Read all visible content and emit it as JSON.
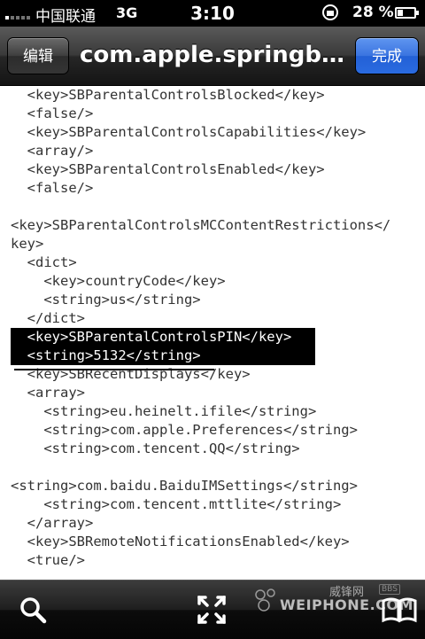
{
  "status_bar": {
    "carrier": "中国联通",
    "network": "3G",
    "time": "3:10",
    "battery_percent": "28 %",
    "signal_bars": 1
  },
  "nav": {
    "edit_label": "编辑",
    "title": "com.apple.springb…",
    "done_label": "完成"
  },
  "document": {
    "lines": [
      {
        "text": "  <key>SBParentalControlsBlocked</key>"
      },
      {
        "text": "  <false/>"
      },
      {
        "text": "  <key>SBParentalControlsCapabilities</key>"
      },
      {
        "text": "  <array/>"
      },
      {
        "text": "  <key>SBParentalControlsEnabled</key>"
      },
      {
        "text": "  <false/>"
      },
      {
        "text": ""
      },
      {
        "text": "<key>SBParentalControlsMCContentRestrictions</"
      },
      {
        "text": "key>"
      },
      {
        "text": "  <dict>"
      },
      {
        "text": "    <key>countryCode</key>"
      },
      {
        "text": "    <string>us</string>"
      },
      {
        "text": "  </dict>"
      },
      {
        "text": "  <key>SBParentalControlsPIN</key>",
        "highlight": true
      },
      {
        "text": "  <string>5132</string>",
        "highlight": true
      },
      {
        "text": "  <key>SBRecentDisplays</key>"
      },
      {
        "text": "  <array>"
      },
      {
        "text": "    <string>eu.heinelt.ifile</string>"
      },
      {
        "text": "    <string>com.apple.Preferences</string>"
      },
      {
        "text": "    <string>com.tencent.QQ</string>"
      },
      {
        "text": ""
      },
      {
        "text": "<string>com.baidu.BaiduIMSettings</string>"
      },
      {
        "text": "    <string>com.tencent.mttlite</string>"
      },
      {
        "text": "  </array>"
      },
      {
        "text": "  <key>SBRemoteNotificationsEnabled</key>"
      },
      {
        "text": "  <true/>"
      }
    ]
  },
  "toolbar": {
    "icons": [
      "search-icon",
      "fullscreen-icon",
      "bookmarks-icon"
    ]
  },
  "watermark": {
    "brand": "WEIPHONE.COM",
    "cn": "威锋网",
    "bbs": "BBS"
  }
}
